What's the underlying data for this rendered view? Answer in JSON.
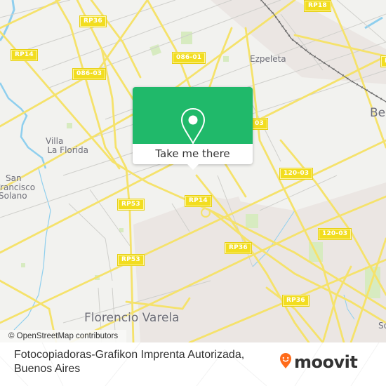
{
  "map": {
    "road_labels": [
      {
        "text": "RP36"
      },
      {
        "text": "RP18"
      },
      {
        "text": "RP14"
      },
      {
        "text": "086-01"
      },
      {
        "text": "086-03"
      },
      {
        "text": "120-03"
      },
      {
        "text": "RP53"
      },
      {
        "text": "RP14"
      },
      {
        "text": "120-03"
      },
      {
        "text": "RP53"
      },
      {
        "text": "RP36"
      },
      {
        "text": "RP36"
      },
      {
        "text": "RP"
      },
      {
        "text": "03"
      }
    ],
    "place_labels": [
      {
        "text": "Ezpeleta"
      },
      {
        "text": "Be"
      },
      {
        "text": "Villa\nLa Florida"
      },
      {
        "text": "San\nFrancisco\nSolano"
      },
      {
        "text": "Florencio Varela"
      },
      {
        "text": "So"
      }
    ],
    "attribution": "© OpenStreetMap contributors",
    "colors": {
      "background": "#f2f2ef",
      "road": "#f5e26b",
      "road_label": "#f2dd1f",
      "urban": "#ebe5e2",
      "park": "#d7ebc0",
      "water": "#8fcfee",
      "rail": "#666666"
    }
  },
  "popup": {
    "icon": "location-pin-icon",
    "cta_label": "Take me there",
    "color": "#20b96a"
  },
  "footer": {
    "title": "Fotocopiadoras-Grafikon Imprenta Autorizada, Buenos Aires",
    "logo_text": "moovit",
    "logo_icon": "moovit-smile-pin-icon",
    "logo_color": "#ff6b1a"
  }
}
